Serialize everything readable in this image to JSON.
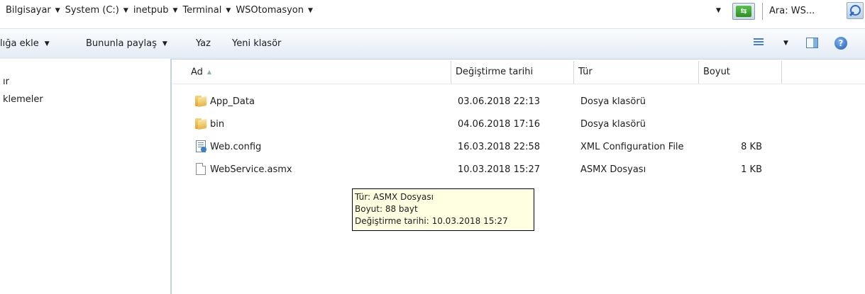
{
  "address": {
    "crumbs": [
      "Bilgisayar",
      "System (C:)",
      "inetpub",
      "Terminal",
      "WSOtomasyon"
    ],
    "search_text": "Ara: WS..."
  },
  "toolbar": {
    "include_library": "lığa ekle",
    "share_with": "Bununla paylaş",
    "burn": "Yaz",
    "new_folder": "Yeni klasör"
  },
  "nav": {
    "items": [
      "ır",
      "klemeler"
    ]
  },
  "columns": {
    "name": "Ad",
    "date": "Değiştirme tarihi",
    "type": "Tür",
    "size": "Boyut"
  },
  "files": [
    {
      "name": "App_Data",
      "date": "03.06.2018 22:13",
      "type": "Dosya klasörü",
      "size": "",
      "icon": "folder-icon"
    },
    {
      "name": "bin",
      "date": "04.06.2018 17:16",
      "type": "Dosya klasörü",
      "size": "",
      "icon": "folder-icon"
    },
    {
      "name": "Web.config",
      "date": "16.03.2018 22:58",
      "type": "XML Configuration File",
      "size": "8 KB",
      "icon": "config-file-icon"
    },
    {
      "name": "WebService.asmx",
      "date": "10.03.2018 15:27",
      "type": "ASMX Dosyası",
      "size": "1 KB",
      "icon": "document-icon"
    }
  ],
  "tooltip": {
    "type_line": "Tür: ASMX Dosyası",
    "size_line": "Boyut: 88 bayt",
    "date_line": "Değiştirme tarihi: 10.03.2018 15:27"
  }
}
